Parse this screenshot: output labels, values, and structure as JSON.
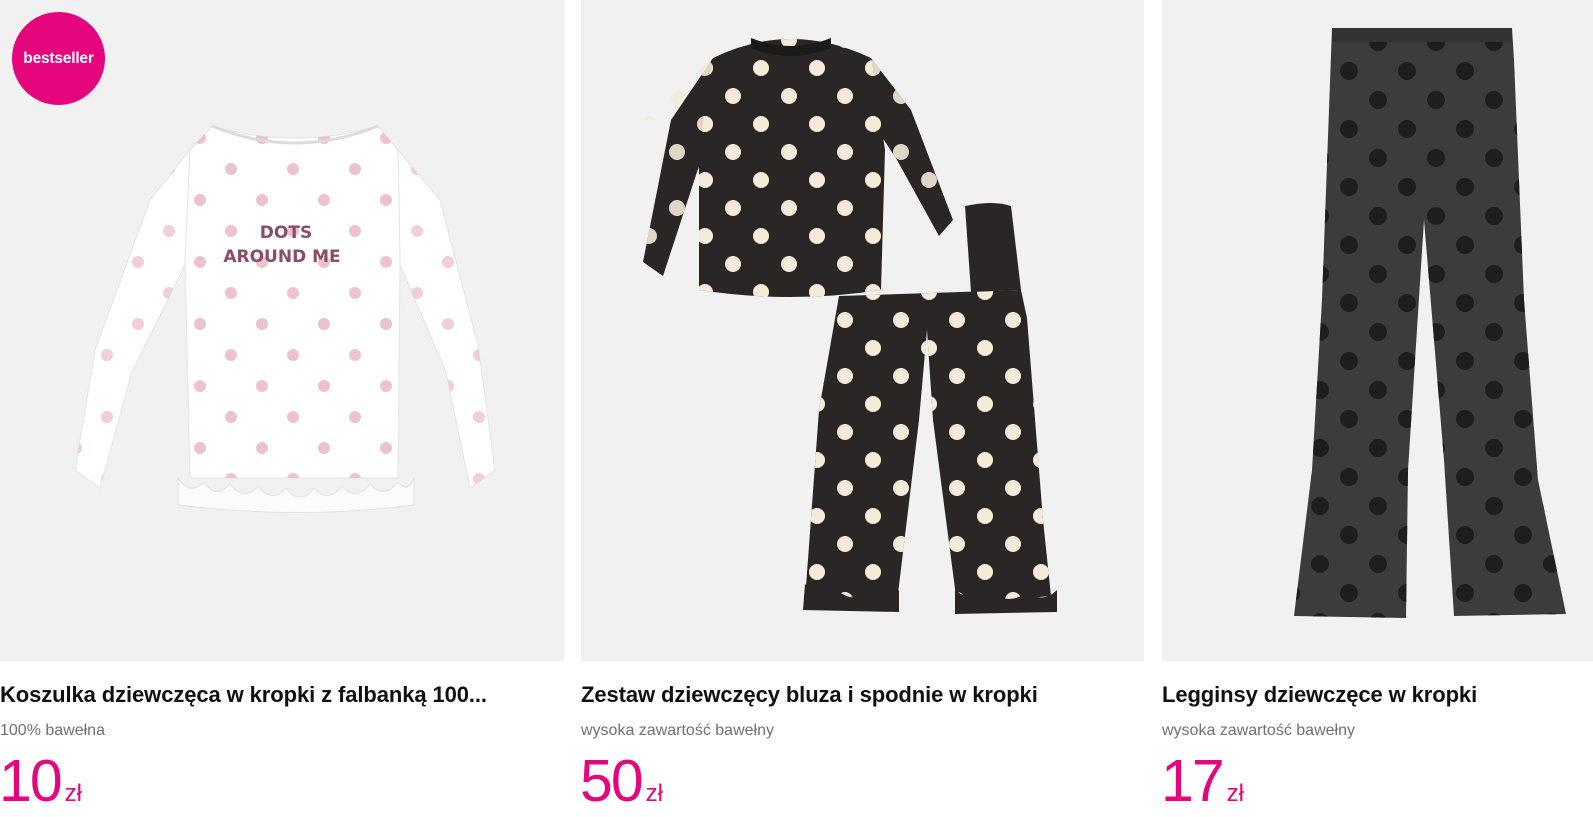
{
  "accent_color": "#e5067e",
  "products": [
    {
      "badge": "bestseller",
      "print_text_line1": "DOTS",
      "print_text_line2": "AROUND ME",
      "title": "Koszulka dziewczęca w kropki z falbanką 100...",
      "subtitle": "100% bawełna",
      "price": "10",
      "currency": "zł",
      "image": "white-polka-dot-long-sleeve-shirt"
    },
    {
      "title": "Zestaw dziewczęcy bluza i spodnie w kropki",
      "subtitle": "wysoka zawartość bawełny",
      "price": "50",
      "currency": "zł",
      "image": "black-polka-dot-sweatshirt-and-trousers"
    },
    {
      "title": "Legginsy dziewczęce w kropki",
      "subtitle": "wysoka zawartość bawełny",
      "price": "17",
      "currency": "zł",
      "image": "grey-polka-dot-flared-leggings"
    }
  ]
}
